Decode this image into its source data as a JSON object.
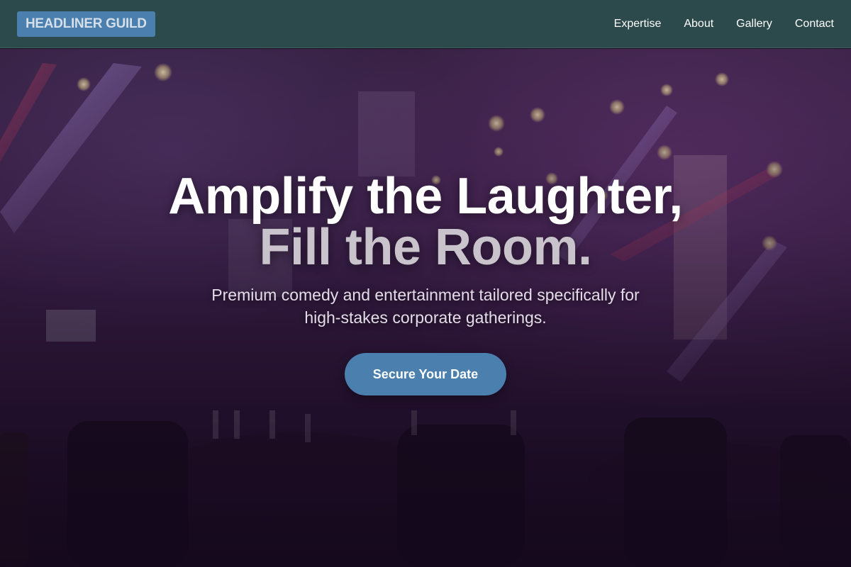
{
  "header": {
    "logo": "HEADLINER GUILD",
    "nav": [
      "Expertise",
      "About",
      "Gallery",
      "Contact"
    ]
  },
  "hero": {
    "headline_line1": "Amplify the Laughter,",
    "headline_line2": "Fill the Room.",
    "subtext_line1": "Premium comedy and entertainment tailored specifically for",
    "subtext_line2": "high-stakes corporate gatherings.",
    "cta": "Secure Your Date",
    "background": "banquet-hall-stage-lights-photo"
  },
  "colors": {
    "header_bg": "#2c4a4b",
    "accent": "#4a7fae",
    "headline_primary": "#ffffff",
    "headline_secondary": "#c9c4cc"
  }
}
